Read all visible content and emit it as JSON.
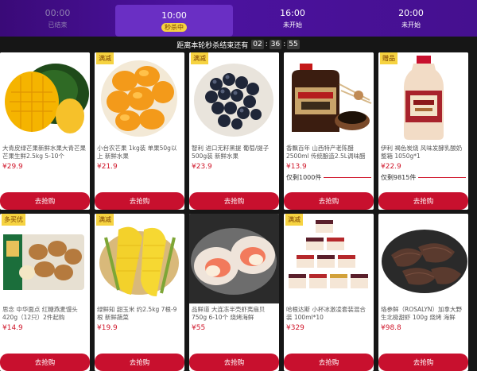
{
  "tabs": [
    {
      "time": "00:00",
      "status": "已结束"
    },
    {
      "time": "10:00",
      "status": "秒杀中"
    },
    {
      "time": "16:00",
      "status": "未开始"
    },
    {
      "time": "20:00",
      "status": "未开始"
    }
  ],
  "countdown": {
    "label": "距离本轮秒杀结束还有",
    "h": "02",
    "m": "36",
    "s": "55"
  },
  "products": [
    {
      "tag": "",
      "title": "大青皮绿芒果新鲜水果大青芒果芒果生鲜2.5kg 5-10个",
      "price": "¥29.9",
      "stock": "",
      "button": "去抢购"
    },
    {
      "tag": "满减",
      "title": "小台农芒果 1kg装 单果50g以上 新鲜水果",
      "price": "¥21.9",
      "stock": "",
      "button": "去抢购"
    },
    {
      "tag": "满减",
      "title": "智利 进口无籽黑提 葡萄/提子 500g装 新鲜水果",
      "price": "¥23.9",
      "stock": "",
      "button": "去抢购"
    },
    {
      "tag": "",
      "title": "香飘百年 山西特产老陈醋 2500ml 传统酿造2.5L调味醋",
      "price": "¥13.9",
      "stock": "仅剩1000件",
      "button": "去抢购"
    },
    {
      "tag": "赠品",
      "title": "伊利 褐色炭烧 风味发酵乳酸奶整箱 1050g*1",
      "price": "¥22.9",
      "stock": "仅剩9815件",
      "button": "去抢购"
    },
    {
      "tag": "多买优",
      "title": "思念 中华面点 红糖燕麦馒头 420g（12只）2件起购",
      "price": "¥14.9",
      "stock": "",
      "button": "去抢购"
    },
    {
      "tag": "满减",
      "title": "绿鲜知 甜玉米 约2.5kg 7根-9根 新鲜蔬菜",
      "price": "¥19.9",
      "stock": "",
      "button": "去抢购"
    },
    {
      "tag": "",
      "title": "品鲜道 大连冻半壳虾夷扇贝 750g 6-10个 烧烤海鲜",
      "price": "¥55",
      "stock": "",
      "button": "去抢购"
    },
    {
      "tag": "满减",
      "title": "哈根达斯 小杯冰激凌套装混合装 100ml*10",
      "price": "¥329",
      "stock": "",
      "button": "去抢购"
    },
    {
      "tag": "",
      "title": "珞参鲜（ROSALYN）加拿大野生北极甜虾 100g 烧烤 海鲜",
      "price": "¥98.8",
      "stock": "",
      "button": "去抢购"
    }
  ]
}
